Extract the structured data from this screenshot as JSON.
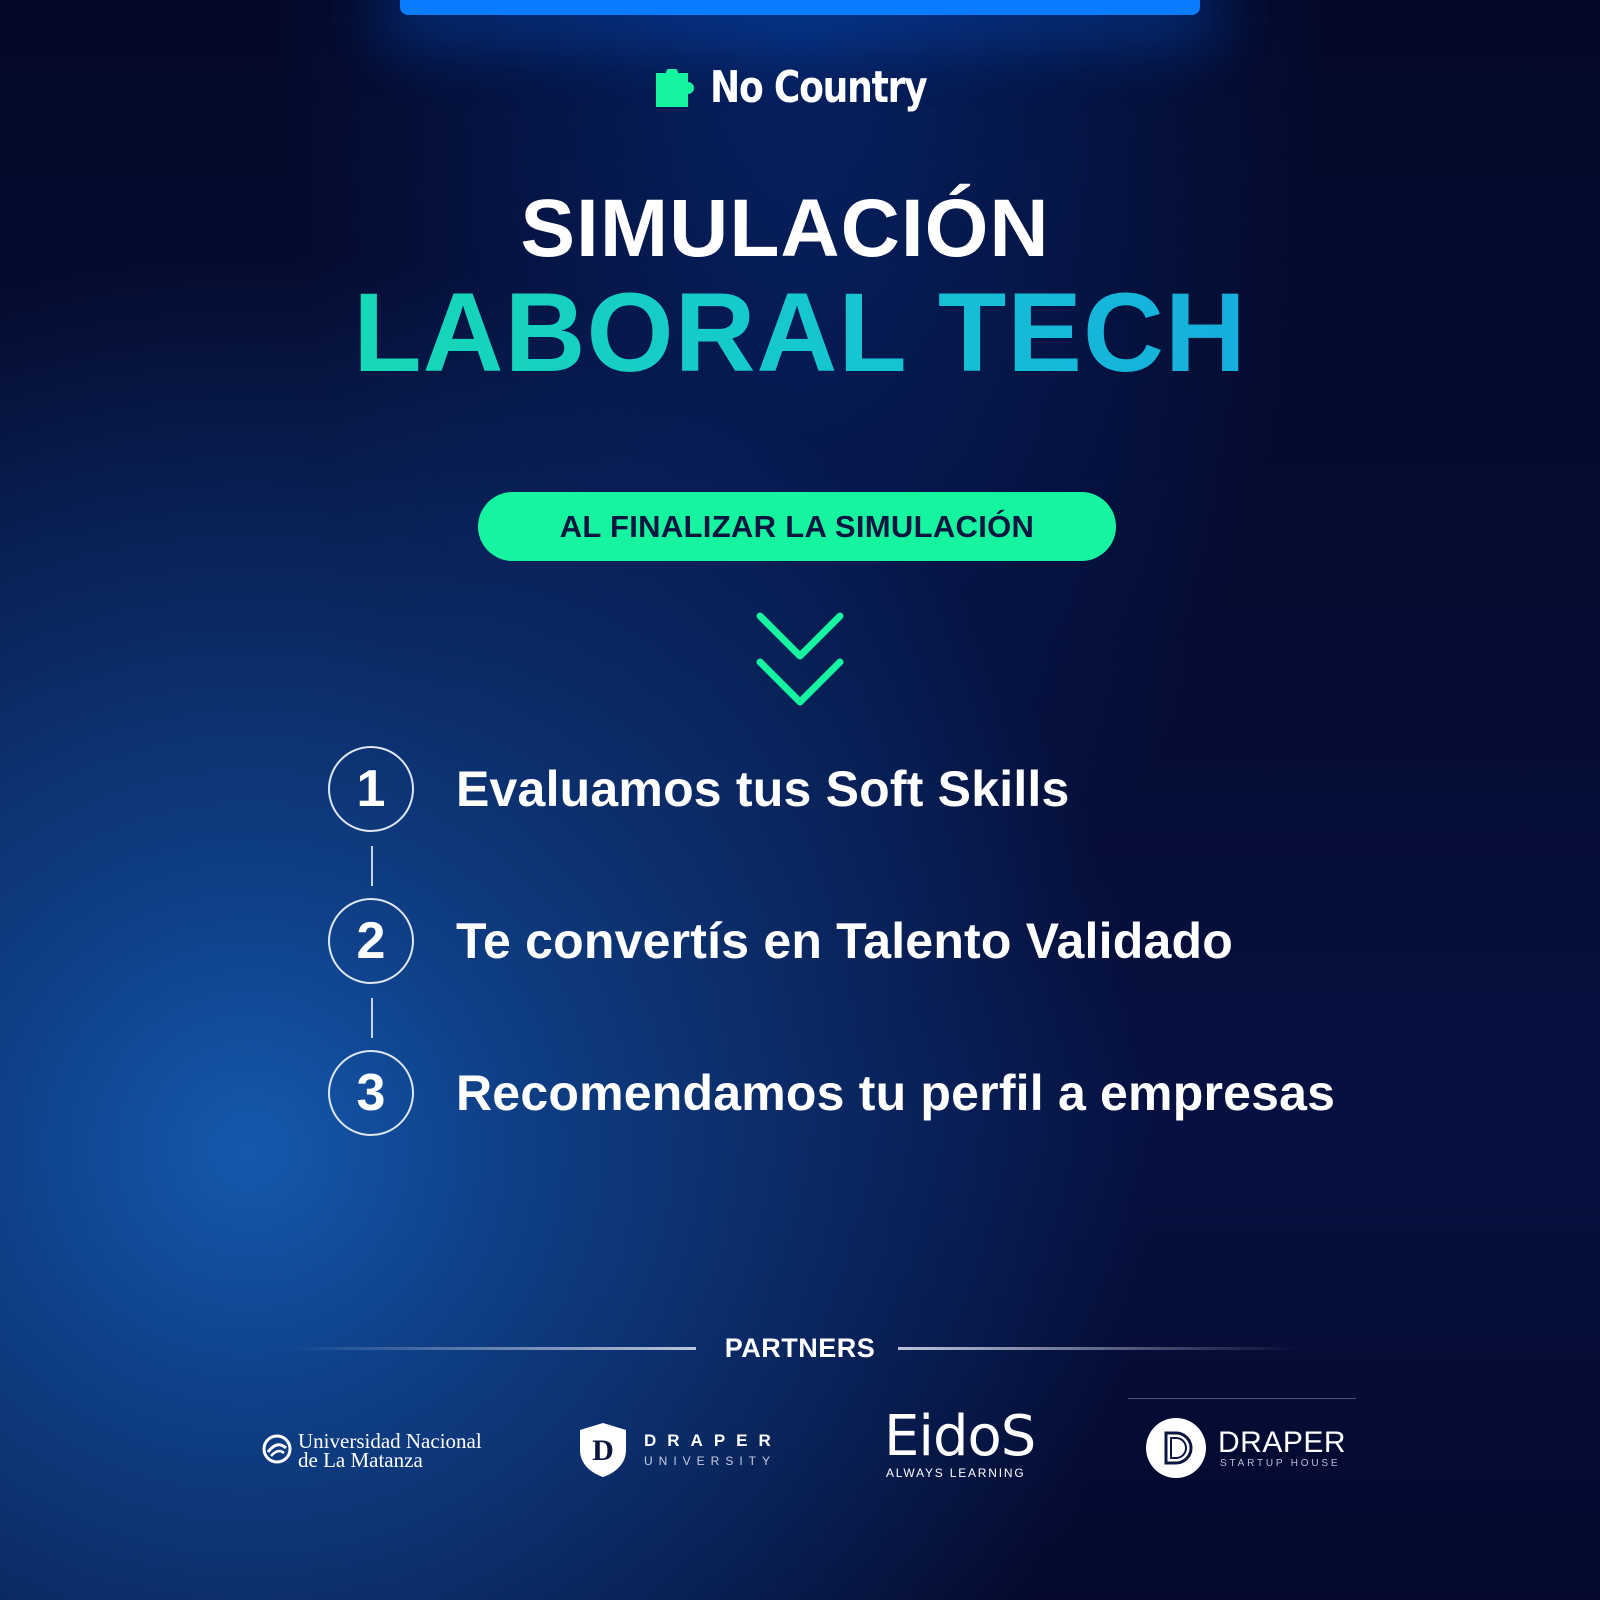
{
  "brand": {
    "name": "No Country",
    "icon": "puzzle-piece-icon",
    "icon_color": "#17f4a0"
  },
  "header": {
    "title_line1": "SIMULACIÓN",
    "title_line2": "LABORAL TECH"
  },
  "callout": {
    "label": "AL FINALIZAR LA SIMULACIÓN",
    "color": "#17f4a0"
  },
  "arrow_icon": "double-chevron-down-icon",
  "steps": [
    {
      "number": "1",
      "text": "Evaluamos tus Soft Skills"
    },
    {
      "number": "2",
      "text": "Te convertís en Talento Validado"
    },
    {
      "number": "3",
      "text": "Recomendamos tu perfil a empresas"
    }
  ],
  "partners": {
    "label": "PARTNERS",
    "logos": [
      {
        "name_line1": "Universidad Nacional",
        "name_line2": "de La Matanza"
      },
      {
        "name": "DRAPER",
        "sub": "UNIVERSITY"
      },
      {
        "name": "EidoS",
        "sub": "ALWAYS LEARNING"
      },
      {
        "name": "DRAPER",
        "sub": "STARTUP HOUSE"
      }
    ]
  },
  "colors": {
    "accent_green": "#17f4a0",
    "accent_blue": "#0a7cff",
    "background": "#050c33"
  }
}
